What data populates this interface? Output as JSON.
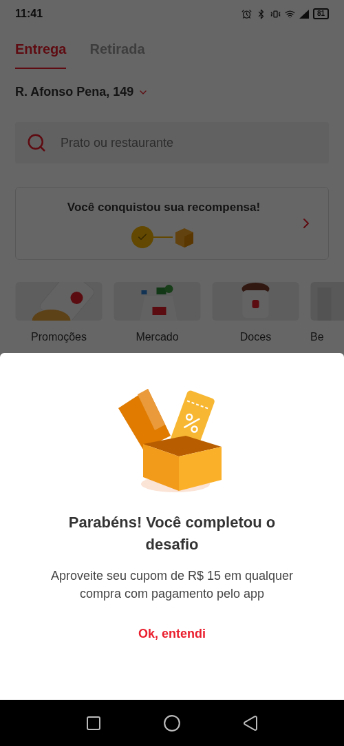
{
  "status_bar": {
    "time": "11:41",
    "battery": "81"
  },
  "tabs": [
    {
      "label": "Entrega",
      "selected": true
    },
    {
      "label": "Retirada",
      "selected": false
    }
  ],
  "address": "R. Afonso Pena, 149",
  "search": {
    "placeholder": "Prato ou restaurante"
  },
  "reward_card": {
    "title": "Você conquistou sua recompensa!",
    "completed": true
  },
  "categories": [
    {
      "label": "Promoções",
      "kind": "promo"
    },
    {
      "label": "Mercado",
      "kind": "market"
    },
    {
      "label": "Doces",
      "kind": "sweets"
    },
    {
      "label": "Be",
      "kind": "blank"
    }
  ],
  "dialog": {
    "title": "Parabéns! Você completou o desafio",
    "message": "Aproveite seu cupom de R$ 15 em qualquer compra com pagamento pelo app",
    "button": "Ok, entendi"
  }
}
